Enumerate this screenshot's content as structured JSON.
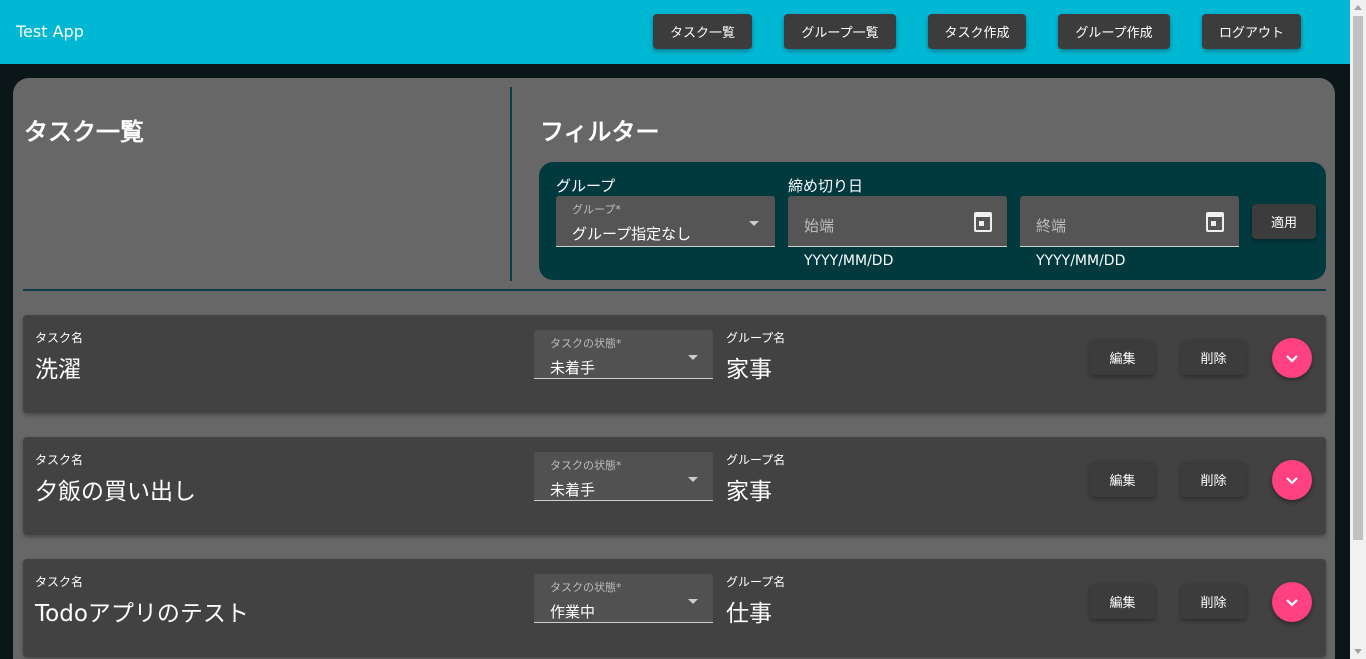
{
  "app": {
    "title": "Test App"
  },
  "nav": [
    {
      "label": "タスク一覧"
    },
    {
      "label": "グループ一覧"
    },
    {
      "label": "タスク作成"
    },
    {
      "label": "グループ作成"
    },
    {
      "label": "ログアウト"
    }
  ],
  "main": {
    "title": "タスク一覧"
  },
  "filter": {
    "title": "フィルター",
    "group_label": "グループ",
    "group_select": {
      "float_label": "グループ*",
      "value": "グループ指定なし"
    },
    "deadline_label": "締め切り日",
    "start": {
      "placeholder": "始端",
      "helper": "YYYY/MM/DD"
    },
    "end": {
      "placeholder": "終端",
      "helper": "YYYY/MM/DD"
    },
    "apply_label": "適用"
  },
  "tasks": [
    {
      "name_label": "タスク名",
      "name": "洗濯",
      "status_label": "タスクの状態*",
      "status": "未着手",
      "group_label": "グループ名",
      "group": "家事",
      "edit_label": "編集",
      "delete_label": "削除"
    },
    {
      "name_label": "タスク名",
      "name": "夕飯の買い出し",
      "status_label": "タスクの状態*",
      "status": "未着手",
      "group_label": "グループ名",
      "group": "家事",
      "edit_label": "編集",
      "delete_label": "削除"
    },
    {
      "name_label": "タスク名",
      "name": "Todoアプリのテスト",
      "status_label": "タスクの状態*",
      "status": "作業中",
      "group_label": "グループ名",
      "group": "仕事",
      "edit_label": "編集",
      "delete_label": "削除"
    }
  ],
  "colors": {
    "appbar": "#00b8d4",
    "panel": "#676767",
    "card": "#424242",
    "filter_bg": "#003a3f",
    "accent": "#ff4081"
  },
  "icons": {
    "calendar": "calendar-icon",
    "dropdown": "caret-down-icon",
    "expand": "chevron-down-icon"
  }
}
